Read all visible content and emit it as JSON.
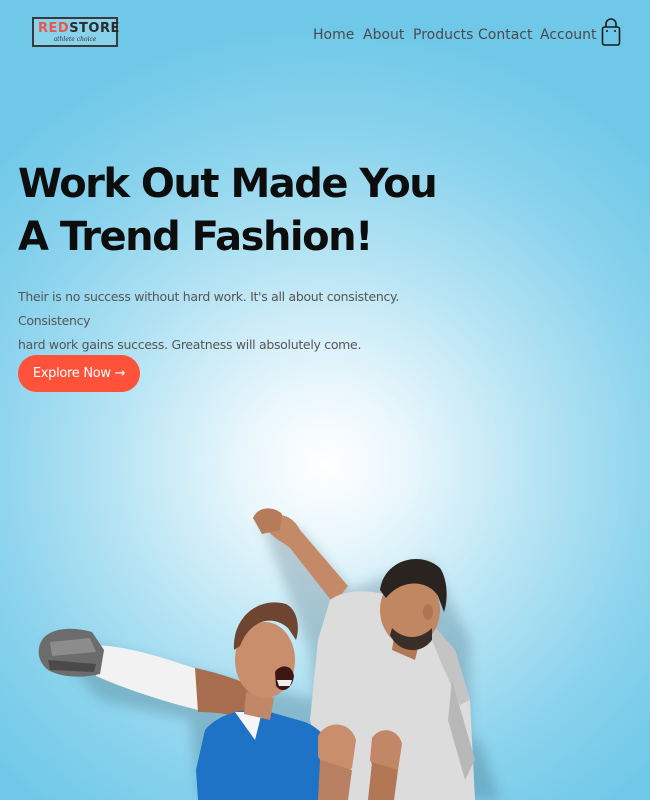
{
  "logo": {
    "red_part": "RED",
    "dark_part": "STORE",
    "tagline": "athlete choice"
  },
  "nav": {
    "items": [
      {
        "label": "Home"
      },
      {
        "label": "About"
      },
      {
        "label": "Products"
      },
      {
        "label": "Contact"
      },
      {
        "label": "Account"
      }
    ],
    "cart_icon": "shopping-bag-icon"
  },
  "hero": {
    "headline_line1": "Work Out Made You",
    "headline_line2": "A Trend Fashion!",
    "description_line1": "Their is no success without hard work. It's all about consistency. Consistency",
    "description_line2": "hard work gains success. Greatness will absolutely come.",
    "button_label": "Explore Now →",
    "image_icon": "celebrating-athletes-image"
  },
  "colors": {
    "accent": "#ff523b",
    "logo_red": "#e8584b",
    "background": "#8ad3ed",
    "text_dark": "#0d0d0d"
  }
}
